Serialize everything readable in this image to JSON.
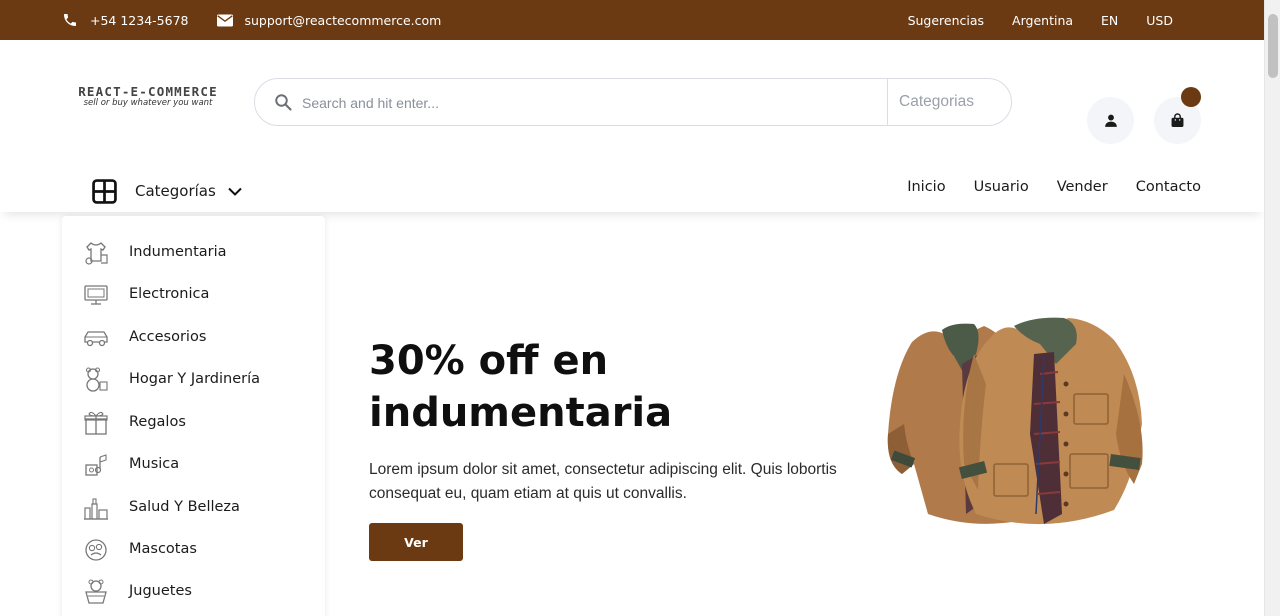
{
  "topbar": {
    "phone": "+54 1234-5678",
    "email": "support@reactecommerce.com",
    "links": [
      "Sugerencias",
      "Argentina",
      "EN",
      "USD"
    ]
  },
  "header": {
    "logo": {
      "title": "REACT-E-COMMERCE",
      "tagline": "sell or buy whatever you want"
    },
    "search": {
      "placeholder": "Search and hit enter...",
      "category": "Categorias"
    }
  },
  "categories_button": {
    "label": "Categorías"
  },
  "nav": {
    "items": [
      "Inicio",
      "Usuario",
      "Vender",
      "Contacto"
    ]
  },
  "sidebar": {
    "items": [
      {
        "label": "Indumentaria",
        "icon": "clothing-icon"
      },
      {
        "label": "Electronica",
        "icon": "computer-icon"
      },
      {
        "label": "Accesorios",
        "icon": "car-icon"
      },
      {
        "label": "Hogar Y Jardinería",
        "icon": "teddy-bear-icon"
      },
      {
        "label": "Regalos",
        "icon": "gift-icon"
      },
      {
        "label": "Musica",
        "icon": "music-icon"
      },
      {
        "label": "Salud Y Belleza",
        "icon": "health-beauty-icon"
      },
      {
        "label": "Mascotas",
        "icon": "pets-icon"
      },
      {
        "label": "Juguetes",
        "icon": "toys-icon"
      }
    ]
  },
  "hero": {
    "title_line1": "30% off en",
    "title_line2": "indumentaria",
    "text": "Lorem ipsum dolor sit amet, consectetur adipiscing elit. Quis lobortis consequat eu, quam etiam at quis ut convallis.",
    "button": "Ver"
  },
  "colors": {
    "brand": "#6b3a12",
    "text": "#1b1b1b",
    "muted": "#8a8f99"
  }
}
